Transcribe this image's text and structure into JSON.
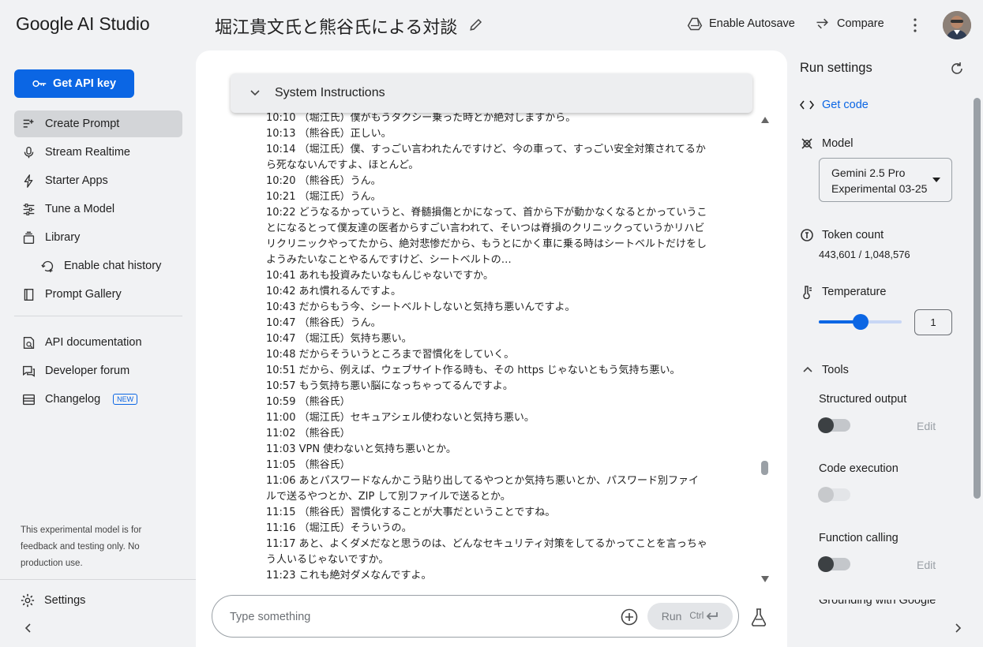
{
  "header": {
    "brand": "Google AI Studio",
    "doc_title": "堀江貴文氏と熊谷氏による対談",
    "autosave_label": "Enable Autosave",
    "compare_label": "Compare"
  },
  "sidebar": {
    "api_key_label": "Get API key",
    "items": [
      {
        "label": "Create Prompt",
        "icon": "create-prompt-icon",
        "active": true
      },
      {
        "label": "Stream Realtime",
        "icon": "mic-icon"
      },
      {
        "label": "Starter Apps",
        "icon": "bolt-icon"
      },
      {
        "label": "Tune a Model",
        "icon": "tune-icon"
      },
      {
        "label": "Library",
        "icon": "library-icon"
      },
      {
        "label": "Enable chat history",
        "icon": "history-icon"
      },
      {
        "label": "Prompt Gallery",
        "icon": "book-icon"
      }
    ],
    "links": [
      {
        "label": "API documentation",
        "icon": "api-doc-icon"
      },
      {
        "label": "Developer forum",
        "icon": "forum-icon"
      },
      {
        "label": "Changelog",
        "icon": "changelog-icon",
        "badge": "NEW"
      }
    ],
    "note": "This experimental model is for feedback and testing only. No production use.",
    "settings_label": "Settings"
  },
  "main": {
    "system_instructions_label": "System Instructions",
    "transcript": [
      "10:10 （堀江氏）僕がもうタクシー乗った時とか絶対しますから。",
      "10:13 （熊谷氏）正しい。",
      "10:14 （堀江氏）僕、すっごい言われたんですけど、今の車って、すっごい安全対策されてるから死なないんですよ、ほとんど。",
      "10:20 （熊谷氏）うん。",
      "10:21 （堀江氏）うん。",
      "10:22 どうなるかっていうと、脊髄損傷とかになって、首から下が動かなくなるとかっていうことになるとって僕友達の医者からすごい言われて、そいつは脊損のクリニックっていうかリハビリクリニックやってたから、絶対悲惨だから、もうとにかく車に乗る時はシートベルトだけをしようみたいなことやるんですけど、シートベルトの…",
      "10:41 あれも投資みたいなもんじゃないですか。",
      "10:42 あれ慣れるんですよ。",
      "10:43 だからもう今、シートベルトしないと気持ち悪いんですよ。",
      "10:47 （熊谷氏）うん。",
      "10:47 （堀江氏）気持ち悪い。",
      "10:48 だからそういうところまで習慣化をしていく。",
      "10:51 だから、例えば、ウェブサイト作る時も、その https じゃないともう気持ち悪い。",
      "10:57 もう気持ち悪い脳になっちゃってるんですよ。",
      "10:59 （熊谷氏）",
      "11:00 （堀江氏）セキュアシェル使わないと気持ち悪い。",
      "11:02 （熊谷氏）",
      "11:03 VPN 使わないと気持ち悪いとか。",
      "11:05 （熊谷氏）",
      "11:06 あとパスワードなんかこう貼り出してるやつとか気持ち悪いとか、パスワード別ファイルで送るやつとか、ZIP して別ファイルで送るとか。",
      "11:15 （熊谷氏）習慣化することが大事だということですね。",
      "11:16 （堀江氏）そういうの。",
      "11:17 あと、よくダメだなと思うのは、どんなセキュリティ対策をしてるかってことを言っちゃう人いるじゃないですか。",
      "11:23 これも絶対ダメなんですよ。"
    ],
    "composer_placeholder": "Type something",
    "run_label": "Run",
    "run_shortcut": "Ctrl"
  },
  "run_settings": {
    "title": "Run settings",
    "get_code_label": "Get code",
    "model_label": "Model",
    "model_value_line1": "Gemini 2.5 Pro",
    "model_value_line2": "Experimental 03-25",
    "token_label": "Token count",
    "token_value": "443,601 / 1,048,576",
    "temperature_label": "Temperature",
    "temperature_value": "1",
    "temperature_fraction": 0.5,
    "tools_label": "Tools",
    "tools": [
      {
        "name": "Structured output",
        "edit": "Edit",
        "enabled": false,
        "disabled": false
      },
      {
        "name": "Code execution",
        "edit": "",
        "enabled": false,
        "disabled": true
      },
      {
        "name": "Function calling",
        "edit": "Edit",
        "enabled": false,
        "disabled": false
      }
    ],
    "grounding_label": "Grounding with Google"
  },
  "colors": {
    "accent": "#0b66e4",
    "background": "#f1f2f4",
    "panel": "#ffffff"
  }
}
